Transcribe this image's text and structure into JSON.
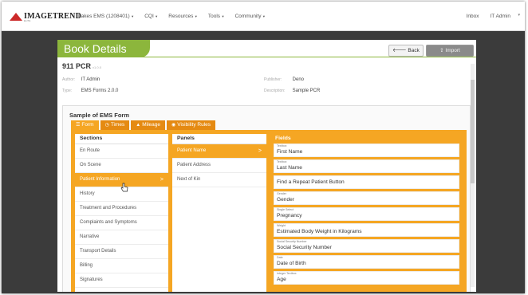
{
  "topbar": {
    "logo_text": "IMAGETREND",
    "logo_sub": "ELITE",
    "nav": [
      {
        "label": "Lakes EMS (1208401)",
        "caret": "chevron-down-icon"
      },
      {
        "label": "CQI",
        "caret": "chevron-down-icon"
      },
      {
        "label": "Resources",
        "caret": "chevron-down-icon"
      },
      {
        "label": "Tools",
        "caret": "chevron-down-icon"
      },
      {
        "label": "Community",
        "caret": "chevron-down-icon"
      }
    ],
    "inbox": "Inbox",
    "user": "IT Admin"
  },
  "page": {
    "title": "Book Details",
    "back_label": "Back",
    "import_label": "Import",
    "book_name": "911 PCR",
    "book_version": "v1.0.0"
  },
  "meta": {
    "author_label": "Author:",
    "author_value": "IT Admin",
    "type_label": "Type:",
    "type_value": "EMS Forms 2.0.0",
    "publisher_label": "Publisher:",
    "publisher_value": "Deno",
    "description_label": "Description:",
    "description_value": "Sample PCR"
  },
  "form": {
    "title": "Sample of EMS Form",
    "tabs": [
      {
        "label": "Form",
        "icon": "list-icon",
        "active": true
      },
      {
        "label": "Times",
        "icon": "clock-icon",
        "active": false
      },
      {
        "label": "Mileage",
        "icon": "road-icon",
        "active": false
      },
      {
        "label": "Visibility Rules",
        "icon": "eye-icon",
        "active": false
      }
    ],
    "sections_header": "Sections",
    "panels_header": "Panels",
    "fields_header": "Fields",
    "sections": [
      {
        "label": "En Route",
        "selected": false
      },
      {
        "label": "On Scene",
        "selected": false
      },
      {
        "label": "Patient Information",
        "selected": true
      },
      {
        "label": "History",
        "selected": false
      },
      {
        "label": "Treatment and Procedures",
        "selected": false
      },
      {
        "label": "Complaints and Symptoms",
        "selected": false
      },
      {
        "label": "Narrative",
        "selected": false
      },
      {
        "label": "Transport Details",
        "selected": false
      },
      {
        "label": "Billing",
        "selected": false
      },
      {
        "label": "Signatures",
        "selected": false
      }
    ],
    "panels": [
      {
        "label": "Patient Name",
        "selected": true
      },
      {
        "label": "Patient Address",
        "selected": false
      },
      {
        "label": "Next of Kin",
        "selected": false
      }
    ],
    "fields": [
      {
        "type": "Textbox",
        "name": "First Name"
      },
      {
        "type": "Textbox",
        "name": "Last Name"
      },
      {
        "type": "",
        "name": "Find a Repeat Patient Button"
      },
      {
        "type": "Gender",
        "name": "Gender"
      },
      {
        "type": "Single Select",
        "name": "Pregnancy"
      },
      {
        "type": "Weight",
        "name": "Estimated Body Weight in Kilograms"
      },
      {
        "type": "Social Security Number",
        "name": "Social Security Number"
      },
      {
        "type": "Date",
        "name": "Date of Birth"
      },
      {
        "type": "Integer Textbox",
        "name": "Age"
      }
    ]
  }
}
